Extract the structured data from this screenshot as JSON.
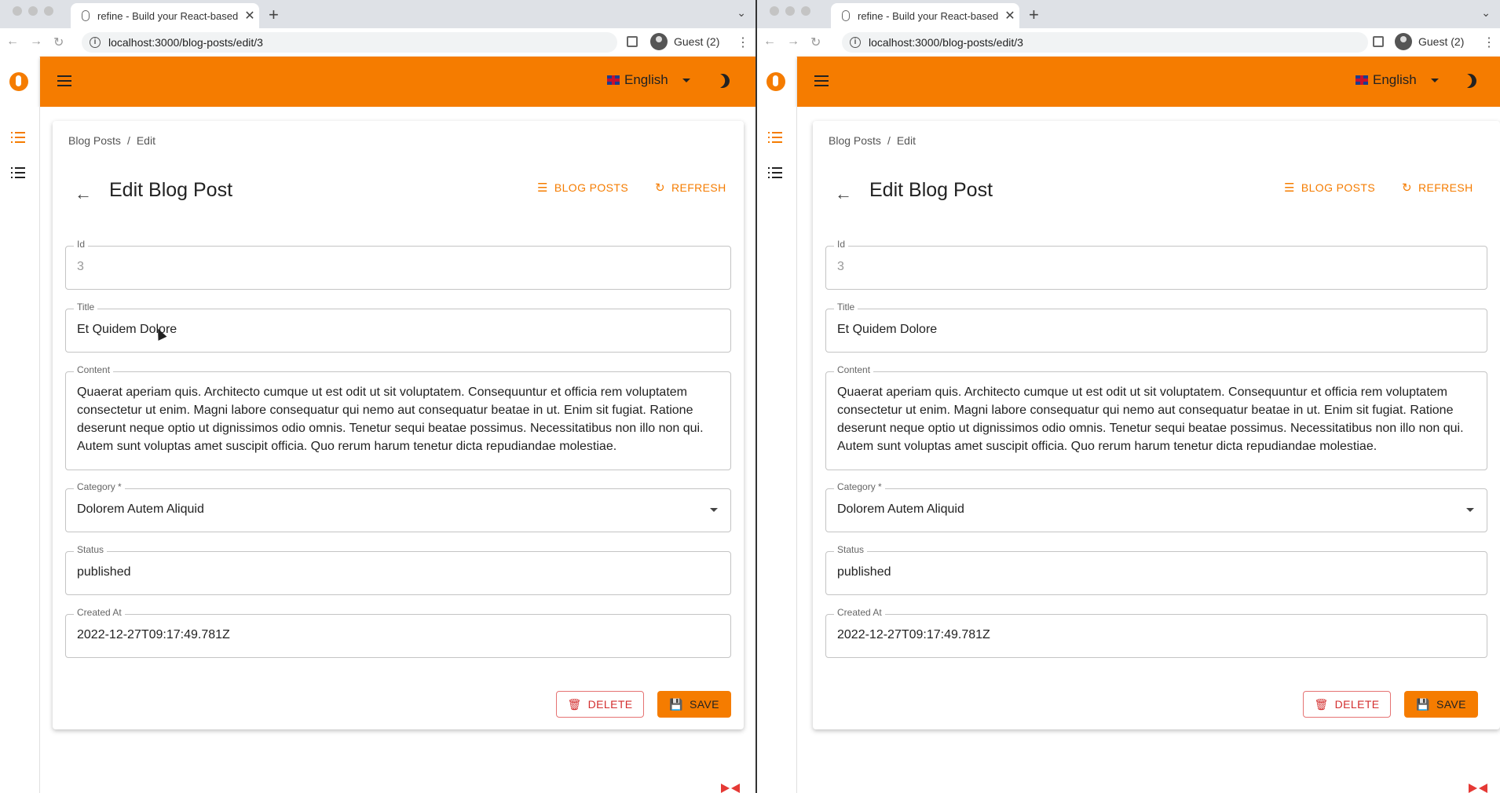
{
  "browser": {
    "tab_title": "refine - Build your React-based",
    "url": "localhost:3000/blog-posts/edit/3",
    "profile": "Guest (2)"
  },
  "app": {
    "language": "English",
    "accent_color": "#f57c00"
  },
  "page": {
    "breadcrumb": [
      "Blog Posts",
      "Edit"
    ],
    "title": "Edit Blog Post",
    "header_buttons": {
      "list": "BLOG POSTS",
      "refresh": "REFRESH"
    }
  },
  "form": {
    "id": {
      "label": "Id",
      "value": "3"
    },
    "title": {
      "label": "Title",
      "value": "Et Quidem Dolore"
    },
    "content": {
      "label": "Content",
      "value": "Quaerat aperiam quis. Architecto cumque ut est odit ut sit voluptatem. Consequuntur et officia rem voluptatem consectetur ut enim. Magni labore consequatur qui nemo aut consequatur beatae in ut. Enim sit fugiat. Ratione deserunt neque optio ut dignissimos odio omnis. Tenetur sequi beatae possimus. Necessitatibus non illo non qui. Autem sunt voluptas amet suscipit officia. Quo rerum harum tenetur dicta repudiandae molestiae."
    },
    "category": {
      "label": "Category *",
      "value": "Dolorem Autem Aliquid"
    },
    "status": {
      "label": "Status",
      "value": "published"
    },
    "created_at": {
      "label": "Created At",
      "value": "2022-12-27T09:17:49.781Z"
    }
  },
  "actions": {
    "delete": "DELETE",
    "save": "SAVE"
  }
}
